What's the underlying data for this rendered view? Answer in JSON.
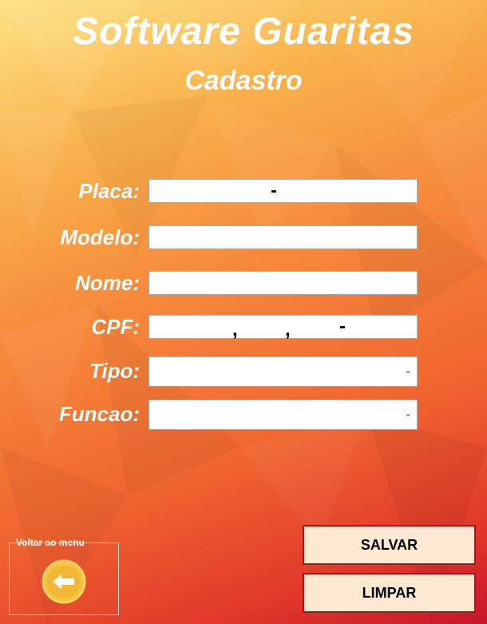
{
  "header": {
    "title": "Software Guaritas",
    "subtitle": "Cadastro"
  },
  "form": {
    "fields": [
      {
        "label": "Placa:",
        "value": ""
      },
      {
        "label": "Modelo:",
        "value": ""
      },
      {
        "label": "Nome:",
        "value": ""
      },
      {
        "label": "CPF:",
        "value": ""
      },
      {
        "label": "Tipo:",
        "value": ""
      },
      {
        "label": "Funcao:",
        "value": ""
      }
    ],
    "masks": {
      "placa": "-",
      "cpf_dot": ",",
      "cpf_dash": "-"
    }
  },
  "buttons": {
    "save_label": "SALVAR",
    "clear_label": "LIMPAR"
  },
  "menu_group": {
    "label": "Voltar ao menu",
    "icon": "arrow-left-icon"
  },
  "colors": {
    "accent_border": "#9b1c20",
    "button_bg": "#fde8d2",
    "icon_yellow": "#f5c43a"
  }
}
